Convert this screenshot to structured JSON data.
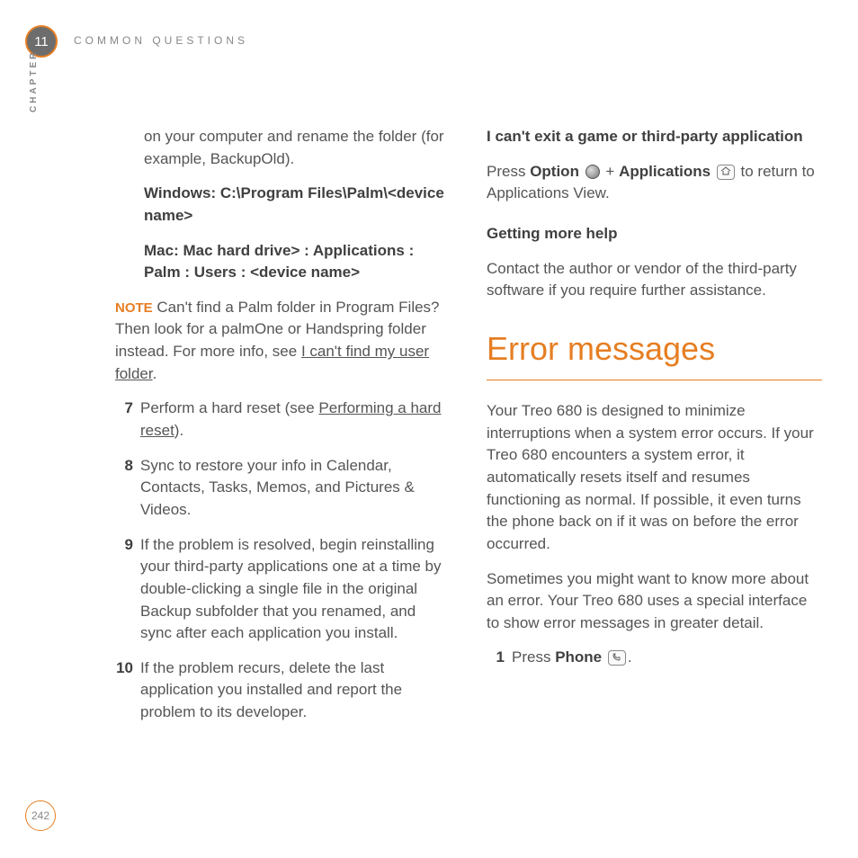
{
  "header": {
    "chapter_num": "11",
    "title": "COMMON QUESTIONS",
    "vertical_label": "CHAPTER"
  },
  "left": {
    "intro": "on your computer and rename the folder (for example, BackupOld).",
    "path_win": "Windows: C:\\Program Files\\Palm\\<device name>",
    "path_mac": "Mac: Mac hard drive> : Applications : Palm : Users : <device name>",
    "note_label": "NOTE",
    "note_a": "Can't find a Palm folder in Program Files? Then look for a palmOne or Handspring folder instead. For more info, see ",
    "note_link": "I can't find my user folder",
    "note_b": ".",
    "steps": [
      {
        "n": "7",
        "pre": "Perform a hard reset (see ",
        "link": "Performing a hard reset",
        "post": ")."
      },
      {
        "n": "8",
        "text": "Sync to restore your info in Calendar, Contacts, Tasks, Memos, and Pictures & Videos."
      },
      {
        "n": "9",
        "text": "If the problem is resolved, begin reinstalling your third-party applications one at a time by double-clicking a single file in the original Backup subfolder that you renamed, and sync after each application you install."
      },
      {
        "n": "10",
        "text": "If the problem recurs, delete the last application you installed and report the problem to its developer."
      }
    ]
  },
  "right": {
    "sub1": "I can't exit a game or third-party application",
    "s1a": "Press ",
    "s1_option": "Option",
    "s1_plus": " + ",
    "s1_apps": "Applications",
    "s1b": " to return to Applications View.",
    "sub2": "Getting more help",
    "s2": "Contact the author or vendor of the third-party software if you require further assistance.",
    "heading": "Error messages",
    "p1": "Your Treo 680 is designed to minimize interruptions when a system error occurs. If your Treo 680 encounters a system error, it automatically resets itself and resumes functioning as normal. If possible, it even turns the phone back on if it was on before the error occurred.",
    "p2": "Sometimes you might want to know more about an error. Your Treo 680 uses a special interface to show error messages in greater detail.",
    "step1_n": "1",
    "step1_a": "Press ",
    "step1_phone": "Phone",
    "step1_b": "."
  },
  "page_number": "242"
}
